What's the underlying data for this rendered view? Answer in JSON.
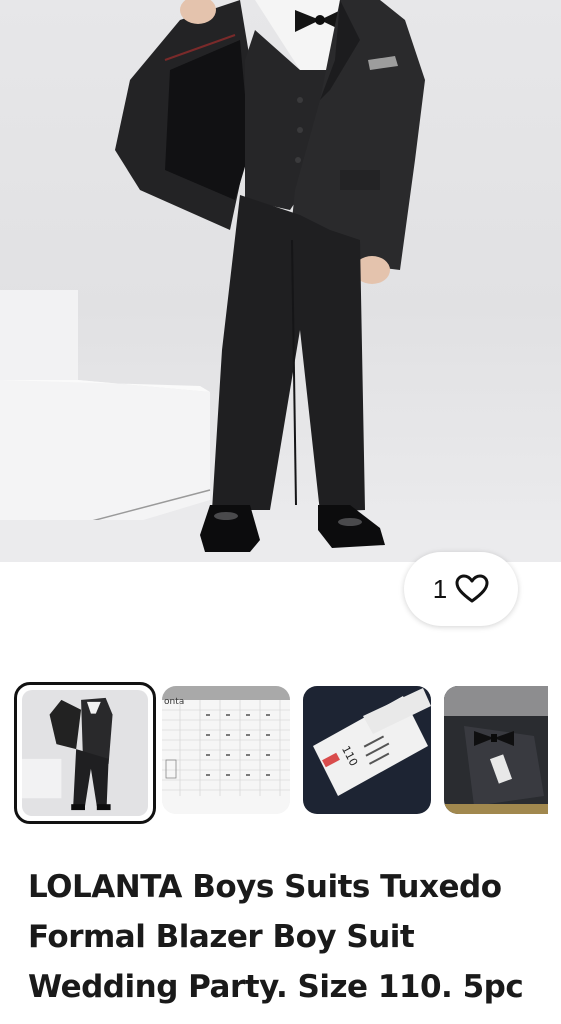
{
  "listing": {
    "title": "LOLANTA Boys Suits Tuxedo Formal Blazer Boy Suit Wedding Party. Size 110. 5pc",
    "like_count": "1"
  },
  "gallery": {
    "selected_index": 0,
    "thumbnails": [
      {
        "subject": "suit-photo"
      },
      {
        "subject": "size-chart",
        "text": "onta"
      },
      {
        "subject": "size-tag",
        "text": "110"
      },
      {
        "subject": "bow-tie-in-bag"
      }
    ]
  },
  "icons": {
    "like": "heart-outline-icon"
  },
  "colors": {
    "suit": "#1d1d1f",
    "background": "#ffffff",
    "selected_border": "#111111"
  }
}
